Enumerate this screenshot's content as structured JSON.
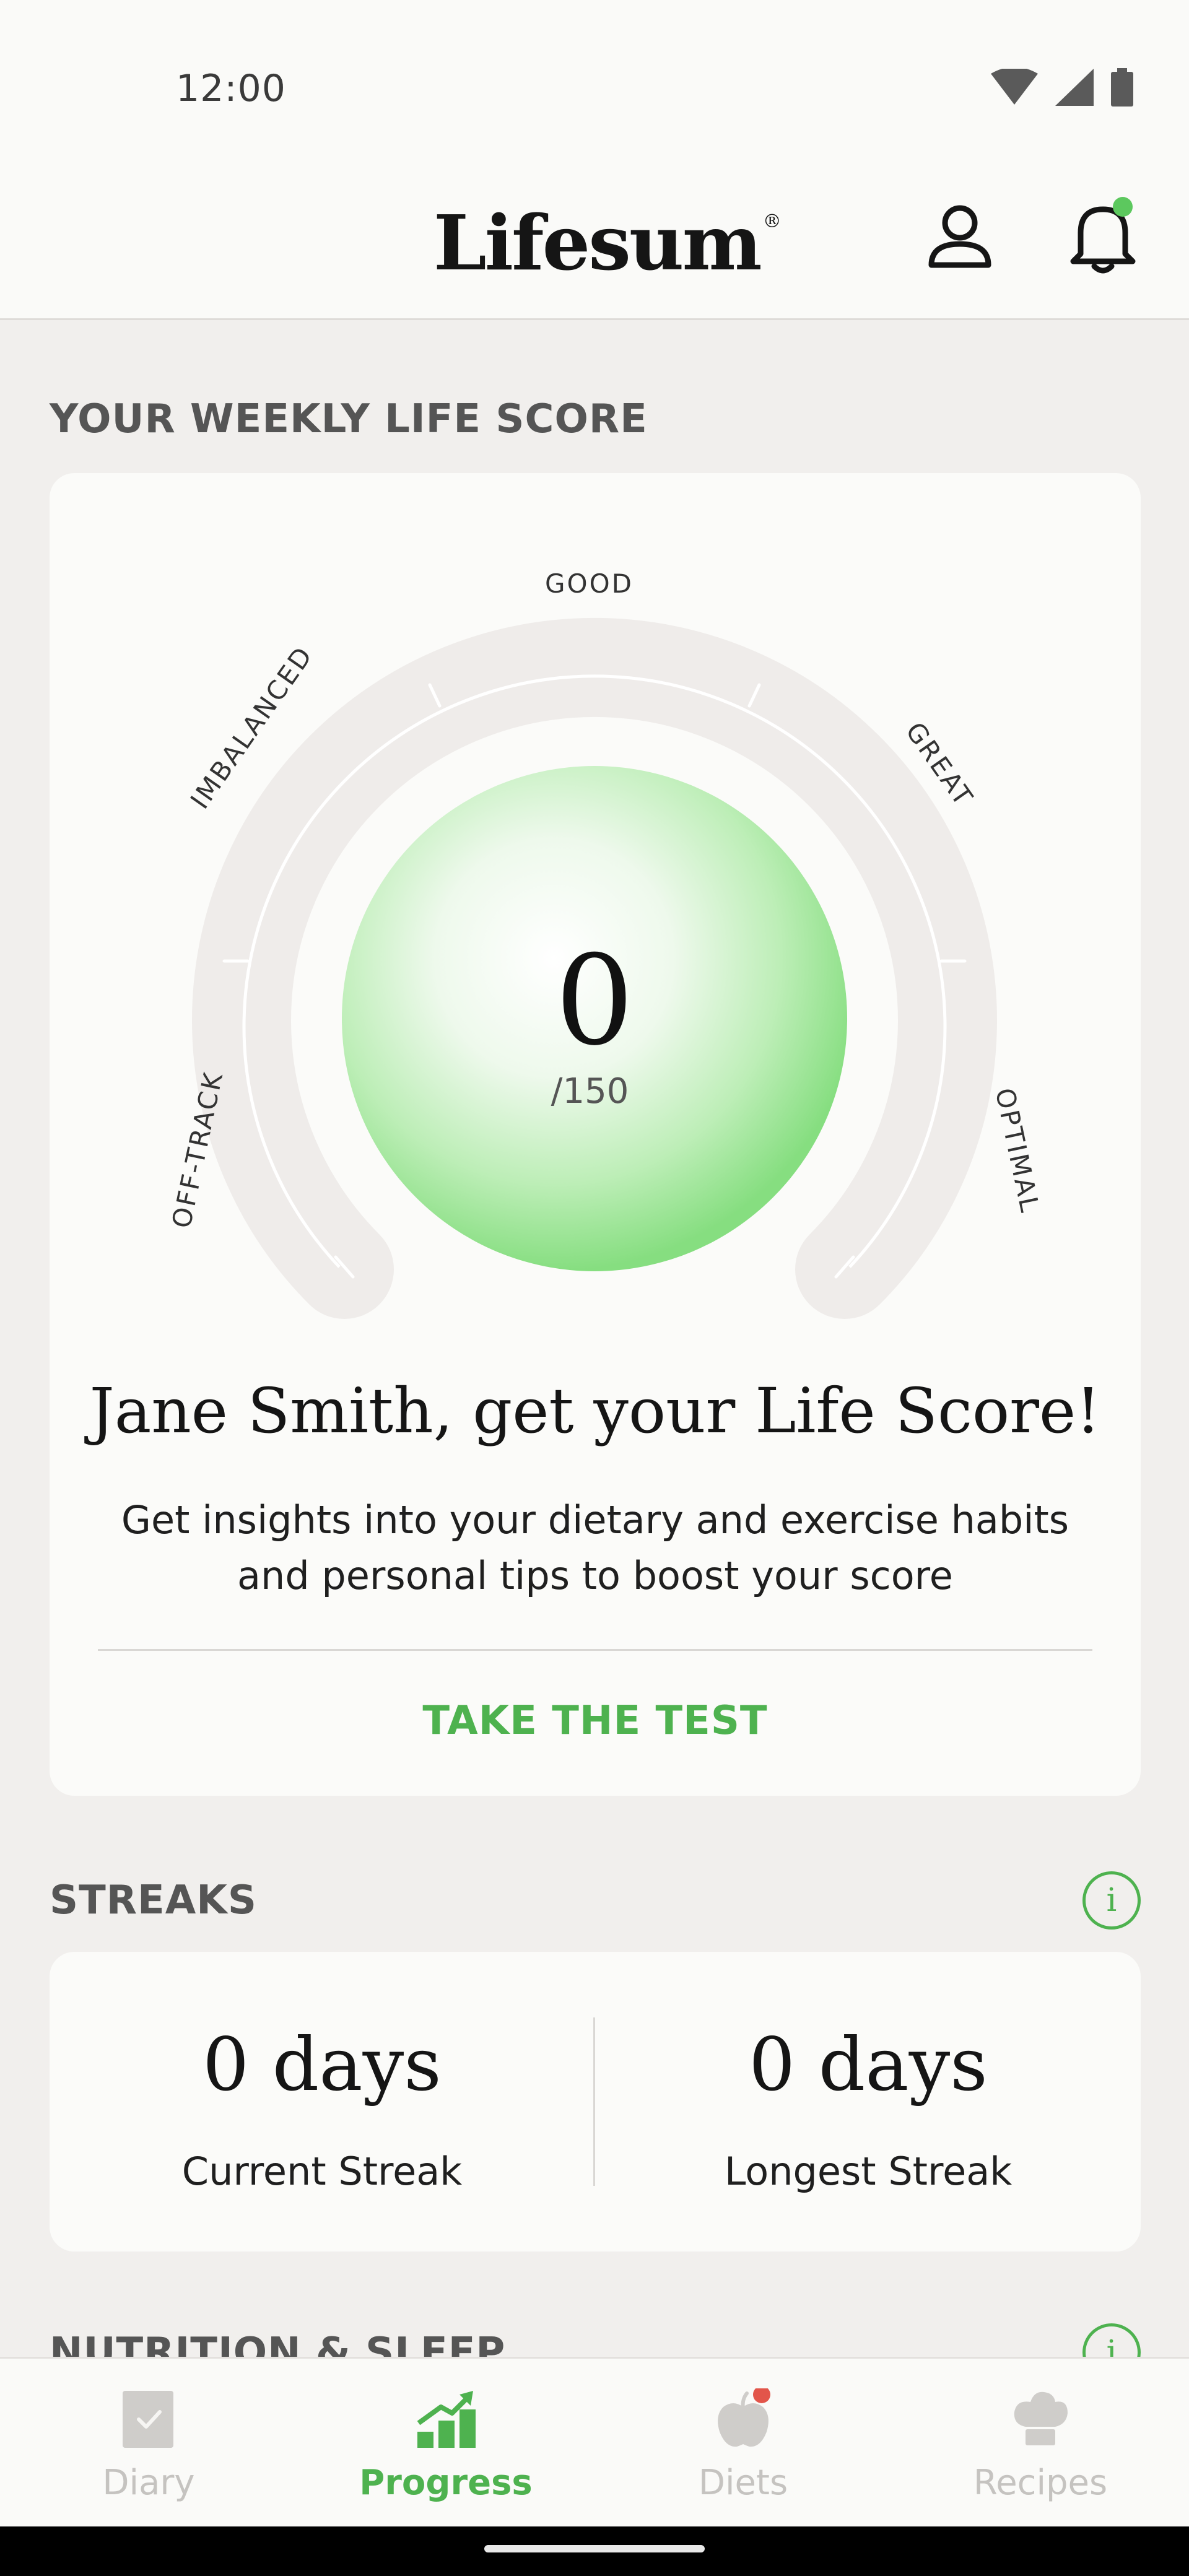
{
  "status_bar": {
    "time": "12:00"
  },
  "app_bar": {
    "logo": "Lifesum",
    "logo_mark": "®"
  },
  "life_score": {
    "section_title": "YOUR WEEKLY LIFE SCORE",
    "gauge_labels": {
      "off_track": "OFF-TRACK",
      "imbalanced": "IMBALANCED",
      "good": "GOOD",
      "great": "GREAT",
      "optimal": "OPTIMAL"
    },
    "score": "0",
    "max": "/150",
    "headline": "Jane Smith, get your Life Score!",
    "subtext": "Get insights into your dietary and exercise habits and personal tips to boost your score",
    "cta": "TAKE THE TEST"
  },
  "streaks": {
    "section_title": "STREAKS",
    "info": "i",
    "current_value": "0 days",
    "current_label": "Current Streak",
    "longest_value": "0 days",
    "longest_label": "Longest Streak"
  },
  "nutrition_sleep": {
    "section_title": "NUTRITION & SLEEP"
  },
  "bottom_nav": {
    "items": [
      {
        "label": "Diary",
        "icon": "diary-icon"
      },
      {
        "label": "Progress",
        "icon": "progress-icon"
      },
      {
        "label": "Diets",
        "icon": "apple-icon"
      },
      {
        "label": "Recipes",
        "icon": "chef-hat-icon"
      }
    ],
    "active": "Progress"
  },
  "colors": {
    "accent": "#4eb24f",
    "notification": "#5cc85e",
    "diets_badge": "#e2554a",
    "background": "#f1efed",
    "card": "#fbfbf9"
  }
}
